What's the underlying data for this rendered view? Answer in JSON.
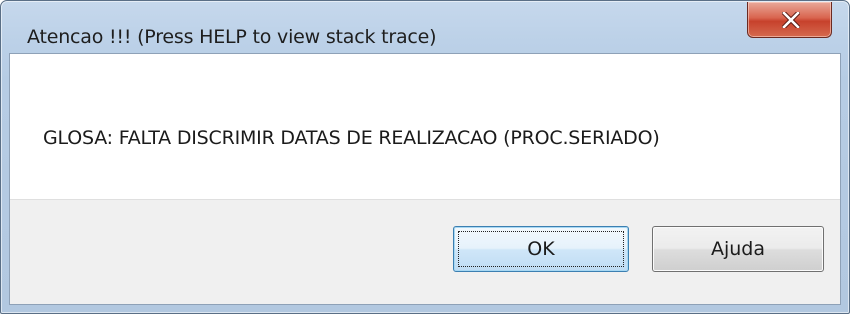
{
  "window": {
    "title": "Atencao !!!  (Press HELP to view stack trace)",
    "close_icon": "close-x-icon"
  },
  "dialog": {
    "message": "GLOSA: FALTA DISCRIMIR DATAS DE REALIZACAO (PROC.SERIADO)"
  },
  "buttons": {
    "ok_label": "OK",
    "help_label": "Ajuda"
  },
  "colors": {
    "title_bar": "#bcd1e8",
    "close_button": "#c7412c",
    "default_button_border": "#3c7fb1",
    "footer": "#f0f0f0"
  }
}
